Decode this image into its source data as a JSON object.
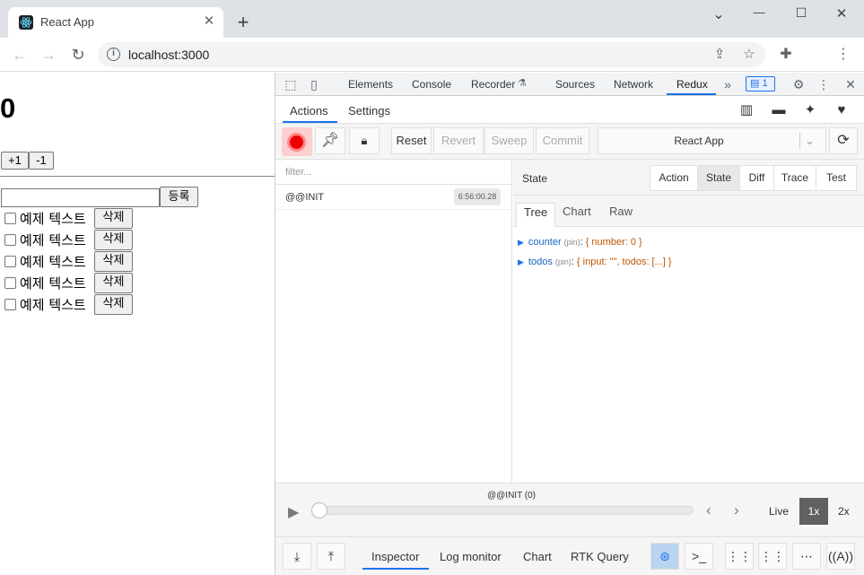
{
  "browser": {
    "tab_title": "React App",
    "tab_close": "✕",
    "new_tab": "+",
    "url": "localhost:3000",
    "window_controls": {
      "minimize": "—",
      "maximize": "☐",
      "close": "✕",
      "dropdown": "⌄"
    }
  },
  "page": {
    "counter_value": "0",
    "increment_label": "+1",
    "decrement_label": "-1",
    "todo_input_value": "",
    "register_label": "등록",
    "todos": [
      {
        "text": "예제 텍스트",
        "delete_label": "삭제",
        "done": false
      },
      {
        "text": "예제 텍스트",
        "delete_label": "삭제",
        "done": false
      },
      {
        "text": "예제 텍스트",
        "delete_label": "삭제",
        "done": false
      },
      {
        "text": "예제 텍스트",
        "delete_label": "삭제",
        "done": false
      },
      {
        "text": "예제 텍스트",
        "delete_label": "삭제",
        "done": false
      }
    ]
  },
  "devtools": {
    "tabs": [
      "Elements",
      "Console",
      "Recorder",
      "Sources",
      "Network",
      "Redux"
    ],
    "active_tab": "Redux",
    "issues_count": "1",
    "more_tabs": "»"
  },
  "redux": {
    "tabs": [
      "Actions",
      "Settings"
    ],
    "active_tab": "Actions",
    "buttons": {
      "reset": "Reset",
      "revert": "Revert",
      "sweep": "Sweep",
      "commit": "Commit"
    },
    "instance": "React App",
    "filter_placeholder": "filter...",
    "actions": [
      {
        "name": "@@INIT",
        "time": "6:56:00.28"
      }
    ],
    "state_header": "State",
    "monitor_tabs": [
      "Action",
      "State",
      "Diff",
      "Trace",
      "Test"
    ],
    "active_monitor_tab": "State",
    "view_tabs": [
      "Tree",
      "Chart",
      "Raw"
    ],
    "active_view_tab": "Tree",
    "tree": [
      {
        "key": "counter",
        "pin": "(pin)",
        "value": "{ number: 0 }"
      },
      {
        "key": "todos",
        "pin": "(pin)",
        "value": "{ input: \"\", todos: [...] }"
      }
    ],
    "slider_label": "@@INIT (0)",
    "live_label": "Live",
    "speed_1x": "1x",
    "speed_2x": "2x",
    "bottom_tabs": [
      "Inspector",
      "Log monitor",
      "Chart",
      "RTK Query"
    ],
    "active_bottom_tab": "Inspector",
    "accent_color": "#1a73e8",
    "record_color": "#ee0000"
  }
}
